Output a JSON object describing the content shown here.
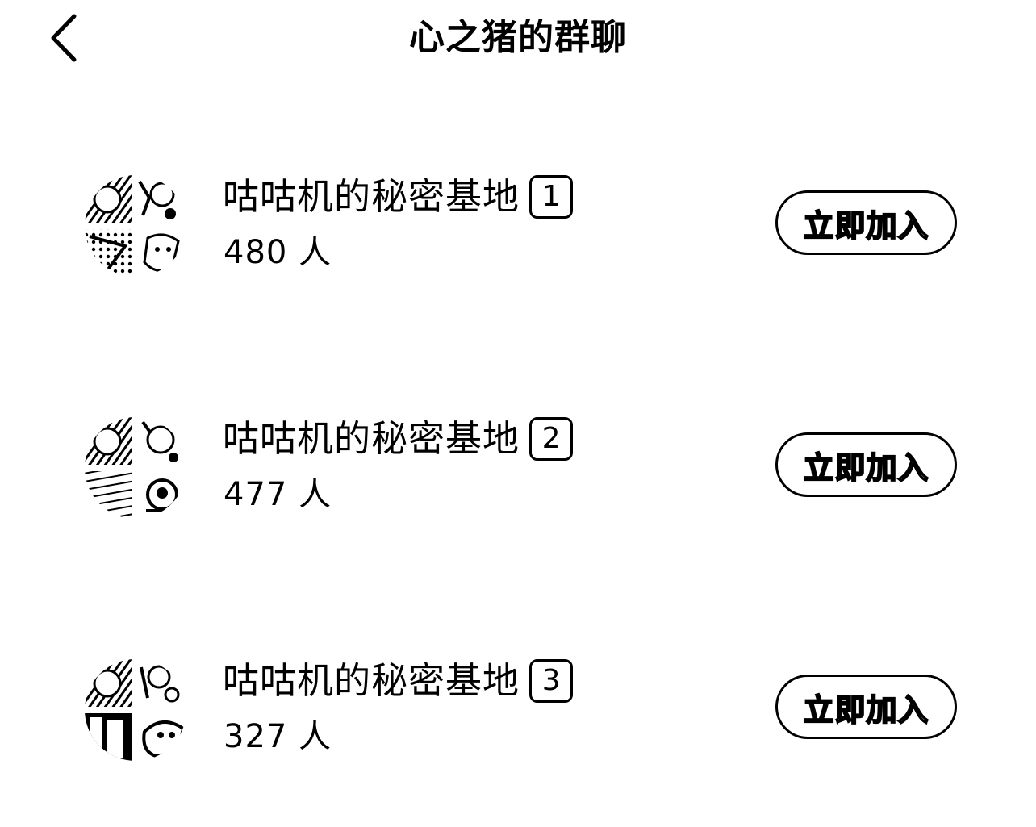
{
  "header": {
    "title": "心之猪的群聊",
    "back_icon": "chevron-left-icon"
  },
  "groups": [
    {
      "name": "咕咕机的秘密基地",
      "badge": "1",
      "members": "480 人",
      "join_label": "立即加入"
    },
    {
      "name": "咕咕机的秘密基地",
      "badge": "2",
      "members": "477 人",
      "join_label": "立即加入"
    },
    {
      "name": "咕咕机的秘密基地",
      "badge": "3",
      "members": "327 人",
      "join_label": "立即加入"
    }
  ],
  "colors": {
    "background": "#ffffff",
    "foreground": "#000000"
  }
}
